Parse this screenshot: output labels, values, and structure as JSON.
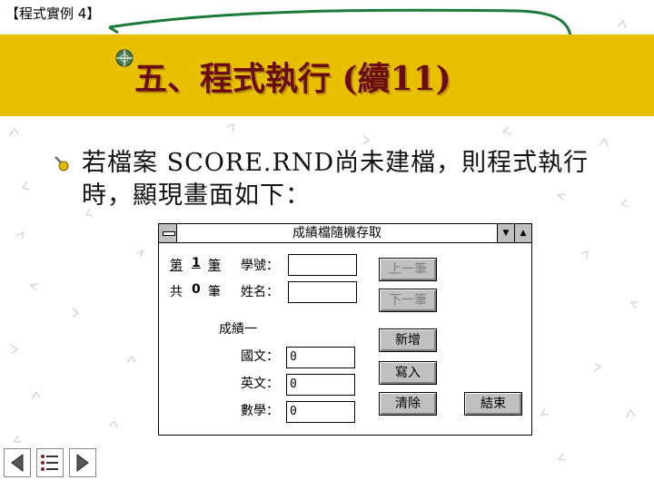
{
  "slide_tag": "【程式實例 4】",
  "title": "五、程式執行 (續11)",
  "bullet_text": "若檔案 SCORE.RND尚未建檔，則程式執行時，顯現畫面如下：",
  "window": {
    "title": "成績檔隨機存取",
    "min_glyph": "▼",
    "max_glyph": "▲",
    "record": {
      "label": "第",
      "value": "1",
      "unit": "筆"
    },
    "total": {
      "label": "共",
      "value": "0",
      "unit": "筆"
    },
    "fields": {
      "id_label": "學號：",
      "name_label": "姓名：",
      "id_value": "",
      "name_value": ""
    },
    "scores": {
      "group_label": "成績一",
      "chinese_label": "國文：",
      "english_label": "英文：",
      "math_label": "數學：",
      "chinese_value": "0",
      "english_value": "0",
      "math_value": "0"
    },
    "buttons": {
      "prev": "上一筆",
      "next": "下一筆",
      "add": "新增",
      "write": "寫入",
      "clear": "清除",
      "exit": "結束"
    }
  },
  "colors": {
    "band": "#e8c000",
    "title": "#6b0b12",
    "window_button": "#c0c0c0"
  }
}
